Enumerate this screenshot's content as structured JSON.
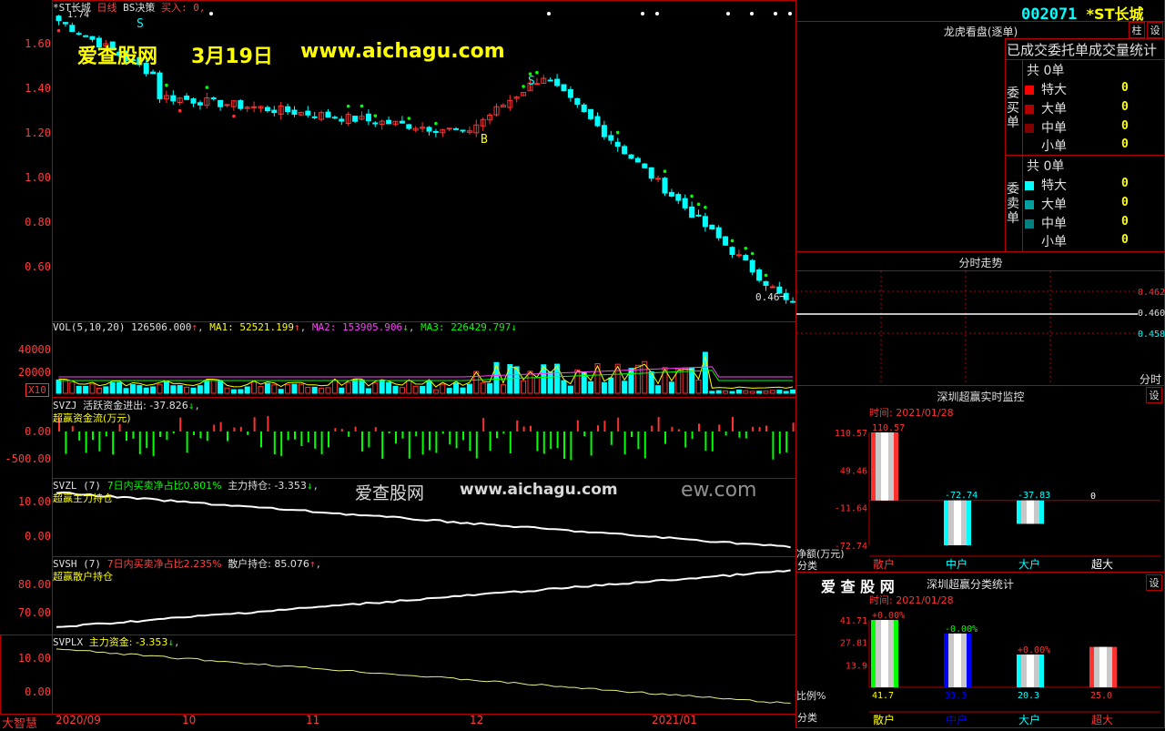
{
  "stock": {
    "code": "002071",
    "name": "*ST长城"
  },
  "main_chart": {
    "header": {
      "name": "*ST长城",
      "period": "日线",
      "strategy": "BS决策",
      "buy_text": "买入: 0,"
    },
    "high_label": "1.74",
    "last_label": "0.46",
    "signal_s": "S",
    "signal_b": "B",
    "y_labels": [
      "1.60",
      "1.40",
      "1.20",
      "1.00",
      "0.80",
      "0.60"
    ],
    "watermark": {
      "name": "爱查股网",
      "date": "3月19日",
      "url": "www.aichagu.com"
    }
  },
  "vol_panel": {
    "header_vol": "VOL(5,10,20)",
    "vol": "126506.000",
    "ma1_label": "MA1:",
    "ma1": "52521.199",
    "ma2_label": "MA2:",
    "ma2": "153905.906",
    "ma3_label": "MA3:",
    "ma3": "226429.797",
    "y_labels": [
      "40000",
      "20000"
    ],
    "unit": "X10"
  },
  "svzj_panel": {
    "header_name": "SVZJ",
    "header_text": "活跃资金进出: -37.826",
    "subtitle": "超赢资金流(万元)",
    "y_labels": [
      "0.00",
      "-500.00"
    ]
  },
  "svzl_panel": {
    "header_name": "SVZL (7)",
    "header_ratio": "7日内买卖净占比0.801%",
    "header_pos": "主力持仓: -3.353",
    "subtitle": "超赢主力持仓",
    "y_labels": [
      "10.00",
      "0.00"
    ],
    "watermark_name": "爱查股网",
    "watermark_url": "www.aichagu.com",
    "watermark_tail": "ew.com"
  },
  "svsh_panel": {
    "header_name": "SVSH (7)",
    "header_ratio": "7日内买卖净占比2.235%",
    "header_pos": "散户持仓: 85.076",
    "subtitle": "超赢散户持仓",
    "y_labels": [
      "80.00",
      "70.00"
    ]
  },
  "svplx_panel": {
    "header_name": "SVPLX",
    "header_text": "主力资金: -3.353",
    "y_labels": [
      "10.00",
      "0.00"
    ]
  },
  "x_axis": {
    "labels": [
      "2020/09",
      "10",
      "11",
      "12",
      "2021/01"
    ],
    "corner_label": "大智慧"
  },
  "dragon_panel": {
    "title": "龙虎看盘(逐单)",
    "subtitle": "已成交委托单成交量统计",
    "btn_pin": "柱",
    "btn_settings": "设",
    "buy_side_label": "委买单",
    "sell_side_label": "委卖单",
    "total_prefix": "共",
    "buy_total": "0单",
    "sell_total": "0单",
    "buy_rows": [
      {
        "label": "特大",
        "value": "0"
      },
      {
        "label": "大单",
        "value": "0"
      },
      {
        "label": "中单",
        "value": "0"
      },
      {
        "label": "小单",
        "value": "0"
      }
    ],
    "sell_rows": [
      {
        "label": "特大",
        "value": "0"
      },
      {
        "label": "大单",
        "value": "0"
      },
      {
        "label": "中单",
        "value": "0"
      },
      {
        "label": "小单",
        "value": "0"
      }
    ]
  },
  "intraday_panel": {
    "title": "分时走势",
    "y_labels": [
      "0.462",
      "0.460",
      "0.458"
    ],
    "x_label": "分时"
  },
  "monitor_panel": {
    "title": "深圳超赢实时监控",
    "btn": "设",
    "time": "时间: 2021/01/28",
    "y_labels": [
      "110.57",
      "49.46",
      "-11.64",
      "-72.74"
    ],
    "axis_name": "净额(万元)",
    "cat_label": "分类",
    "chart_data": {
      "type": "bar",
      "categories": [
        "散户",
        "中户",
        "大户",
        "超大"
      ],
      "values": [
        110.57,
        -72.74,
        -37.83,
        0
      ],
      "value_labels": [
        "110.57",
        "-72.74",
        "-37.83",
        "0"
      ],
      "ylim": [
        -72.74,
        110.57
      ]
    }
  },
  "stat_panel": {
    "brand": "爱 查 股 网",
    "title": "深圳超赢分类统计",
    "btn": "设",
    "time": "时间: 2021/01/28",
    "y_labels": [
      "41.71",
      "27.81",
      "13.9"
    ],
    "axis_name": "比例%",
    "cat_label": "分类",
    "chart_data": {
      "type": "bar",
      "categories": [
        "散户",
        "中户",
        "大户",
        "超大"
      ],
      "values": [
        41.7,
        33.3,
        20.3,
        25.0
      ],
      "value_labels": [
        "41.7",
        "33.3",
        "20.3",
        "25.0"
      ],
      "change_labels": [
        "+0.00%",
        "-0.00%",
        "+0.00%",
        ""
      ],
      "ylim": [
        0,
        41.71
      ]
    }
  },
  "colors": {
    "up": "#ff3232",
    "down": "#00ffff",
    "grid": "#b40000",
    "cyan": "#00ffff",
    "yellow": "#ffff00",
    "green": "#00ff00",
    "magenta": "#ff40ff"
  }
}
